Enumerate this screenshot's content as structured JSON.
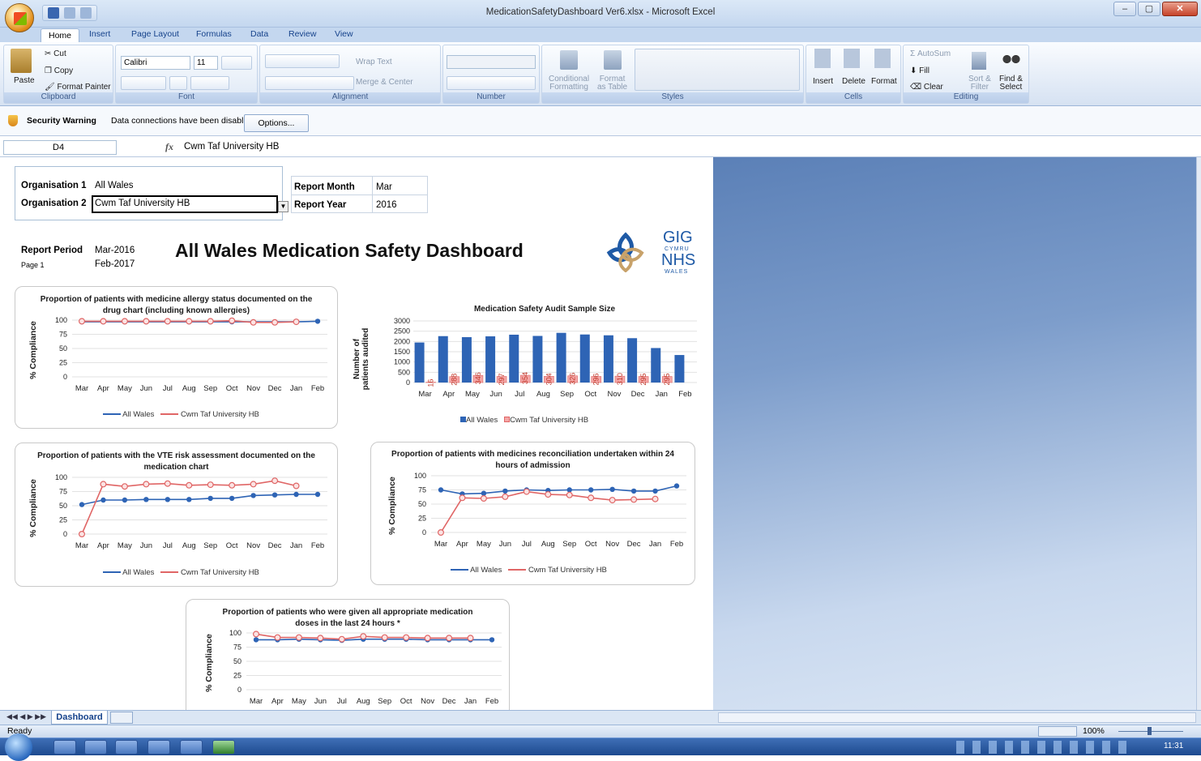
{
  "window": {
    "title": "MedicationSafetyDashboard Ver6.xlsx - Microsoft Excel",
    "minimize": "–",
    "restore": "▢",
    "close": "✕"
  },
  "ribbon": {
    "tabs": [
      "Home",
      "Insert",
      "Page Layout",
      "Formulas",
      "Data",
      "Review",
      "View"
    ],
    "clipboard": {
      "paste": "Paste",
      "cut": "Cut",
      "copy": "Copy",
      "format_painter": "Format Painter",
      "label": "Clipboard"
    },
    "font": {
      "name": "Calibri",
      "size": "11",
      "label": "Font"
    },
    "alignment": {
      "wrap": "Wrap Text",
      "merge": "Merge & Center",
      "label": "Alignment"
    },
    "number": {
      "label": "Number"
    },
    "styles": {
      "conditional": "Conditional",
      "conditional2": "Formatting",
      "format_as": "Format",
      "format_as2": "as Table",
      "label": "Styles"
    },
    "cells": {
      "insert": "Insert",
      "delete": "Delete",
      "format": "Format",
      "label": "Cells"
    },
    "editing": {
      "autosum": "AutoSum",
      "fill": "Fill",
      "clear": "Clear",
      "sort": "Sort &",
      "sort2": "Filter",
      "find": "Find &",
      "find2": "Select",
      "label": "Editing"
    }
  },
  "security": {
    "warning": "Security Warning",
    "message": "Data connections have been disabled",
    "options": "Options..."
  },
  "formula_bar": {
    "cell_ref": "D4",
    "fx": "fx",
    "value": "Cwm Taf University HB"
  },
  "header": {
    "org1_label": "Organisation 1",
    "org1_value": "All Wales",
    "org2_label": "Organisation 2",
    "org2_value": "Cwm Taf University HB",
    "month_label": "Report Month",
    "month_value": "Mar",
    "year_label": "Report Year",
    "year_value": "2016",
    "period_label": "Report Period",
    "period_start": "Mar-2016",
    "period_end": "Feb-2017",
    "page": "Page 1",
    "title": "All Wales Medication Safety Dashboard",
    "logo_top": "GIG",
    "logo_mid": "CYMRU",
    "logo_nhs": "NHS",
    "logo_bot": "WALES"
  },
  "chart_data": [
    {
      "type": "line",
      "title": "Proportion of patients with medicine allergy status documented on the drug chart (including known allergies)",
      "ylabel": "% Compliance",
      "ylim": [
        0,
        100
      ],
      "categories": [
        "Mar",
        "Apr",
        "May",
        "Jun",
        "Jul",
        "Aug",
        "Sep",
        "Oct",
        "Nov",
        "Dec",
        "Jan",
        "Feb"
      ],
      "series": [
        {
          "name": "All Wales",
          "values": [
            97,
            97,
            97,
            97,
            97,
            97,
            97,
            97,
            97,
            97,
            97,
            98
          ],
          "color": "#2e64b5"
        },
        {
          "name": "Cwm Taf University HB",
          "values": [
            98,
            98,
            98,
            98,
            98,
            98,
            98,
            99,
            96,
            96,
            97,
            null
          ],
          "color": "#e06666"
        }
      ]
    },
    {
      "type": "bar",
      "title": "Medication Safety Audit Sample Size",
      "ylabel": "Number of patients audited",
      "ylim": [
        0,
        3000
      ],
      "categories": [
        "Mar",
        "Apr",
        "May",
        "Jun",
        "Jul",
        "Aug",
        "Sep",
        "Oct",
        "Nov",
        "Dec",
        "Jan",
        "Feb"
      ],
      "series": [
        {
          "name": "All Wales",
          "values": [
            1950,
            2260,
            2210,
            2250,
            2330,
            2270,
            2420,
            2340,
            2300,
            2160,
            1680,
            1340
          ],
          "color": "#2e64b5"
        },
        {
          "name": "Cwm Taf University HB",
          "values": [
            16,
            288,
            346,
            297,
            354,
            304,
            326,
            296,
            310,
            295,
            295,
            null
          ],
          "color": "#f4a7a7"
        }
      ]
    },
    {
      "type": "line",
      "title": "Proportion of patients with the VTE risk assessment documented on the medication chart",
      "ylabel": "% Compliance",
      "ylim": [
        0,
        100
      ],
      "categories": [
        "Mar",
        "Apr",
        "May",
        "Jun",
        "Jul",
        "Aug",
        "Sep",
        "Oct",
        "Nov",
        "Dec",
        "Jan",
        "Feb"
      ],
      "series": [
        {
          "name": "All Wales",
          "values": [
            52,
            60,
            60,
            61,
            61,
            61,
            63,
            63,
            68,
            69,
            70,
            70
          ],
          "color": "#2e64b5"
        },
        {
          "name": "Cwm Taf University HB",
          "values": [
            0,
            88,
            84,
            88,
            89,
            86,
            87,
            86,
            88,
            94,
            85,
            null
          ],
          "color": "#e06666"
        }
      ]
    },
    {
      "type": "line",
      "title": "Proportion of patients with medicines reconciliation undertaken within 24 hours of admission",
      "ylabel": "% Compliance",
      "ylim": [
        0,
        100
      ],
      "categories": [
        "Mar",
        "Apr",
        "May",
        "Jun",
        "Jul",
        "Aug",
        "Sep",
        "Oct",
        "Nov",
        "Dec",
        "Jan",
        "Feb"
      ],
      "series": [
        {
          "name": "All Wales",
          "values": [
            75,
            68,
            69,
            73,
            75,
            74,
            75,
            75,
            76,
            73,
            73,
            82
          ],
          "color": "#2e64b5"
        },
        {
          "name": "Cwm Taf University HB",
          "values": [
            0,
            61,
            60,
            63,
            72,
            67,
            66,
            61,
            57,
            58,
            59,
            null
          ],
          "color": "#e06666"
        }
      ]
    },
    {
      "type": "line",
      "title": "Proportion of patients who were given all appropriate medication doses in the last 24 hours *",
      "ylabel": "% Compliance",
      "ylim": [
        0,
        100
      ],
      "categories": [
        "Mar",
        "Apr",
        "May",
        "Jun",
        "Jul",
        "Aug",
        "Sep",
        "Oct",
        "Nov",
        "Dec",
        "Jan",
        "Feb"
      ],
      "series": [
        {
          "name": "All Wales",
          "values": [
            88,
            88,
            89,
            88,
            87,
            89,
            89,
            89,
            88,
            88,
            88,
            88
          ],
          "color": "#2e64b5"
        },
        {
          "name": "Cwm Taf University HB",
          "values": [
            98,
            92,
            92,
            91,
            89,
            94,
            92,
            92,
            91,
            91,
            91,
            null
          ],
          "color": "#e06666"
        }
      ]
    }
  ],
  "sheet_tab": "Dashboard",
  "status": {
    "ready": "Ready",
    "zoom": "100%"
  },
  "clock": "11:31"
}
